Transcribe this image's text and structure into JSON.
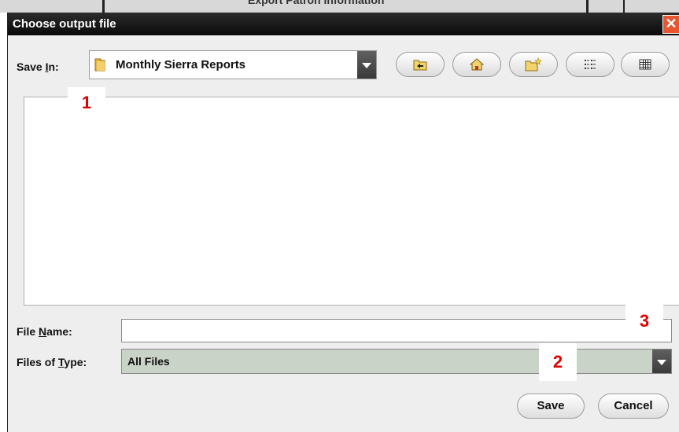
{
  "background": {
    "title": "Export Patron Information"
  },
  "dialog": {
    "title": "Choose output file",
    "close_glyph": "✕"
  },
  "save_in": {
    "label_prefix": "Save ",
    "label_mnemonic": "I",
    "label_suffix": "n:",
    "value": "Monthly Sierra Reports"
  },
  "toolbar": {
    "icons": [
      "up-one-level-icon",
      "home-icon",
      "new-folder-icon",
      "list-view-icon",
      "details-view-icon"
    ]
  },
  "file_name": {
    "label_prefix": "File ",
    "label_mnemonic": "N",
    "label_suffix": "ame:",
    "value": ""
  },
  "files_of_type": {
    "label_prefix": "Files of ",
    "label_mnemonic": "T",
    "label_suffix": "ype:",
    "value": "All Files"
  },
  "buttons": {
    "save": "Save",
    "cancel": "Cancel"
  },
  "annotations": {
    "a1": "1",
    "a2": "2",
    "a3": "3"
  },
  "colors": {
    "title_bar": "#111111",
    "close": "#e8552f",
    "annotation": "#e00000",
    "type_combo": "#cad3c7"
  }
}
